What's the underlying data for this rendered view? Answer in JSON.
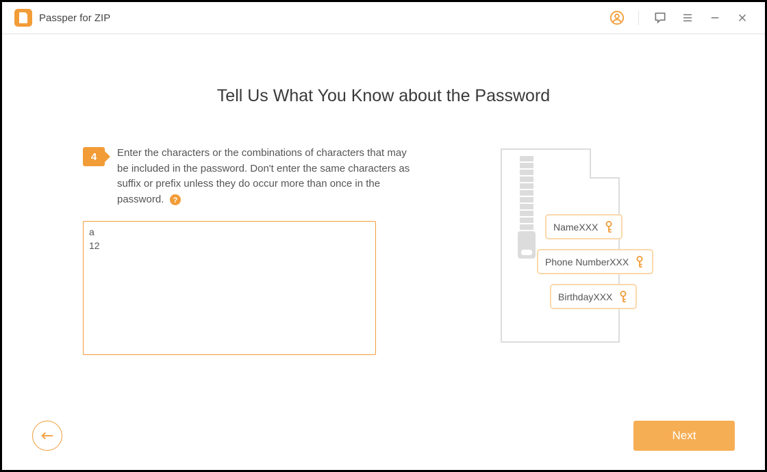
{
  "app": {
    "title": "Passper for ZIP"
  },
  "heading": "Tell Us What You Know about the Password",
  "step": {
    "number": "4",
    "description": "Enter the characters or the combinations of characters that may be included in the password. Don't enter the same characters as suffix or prefix unless they do occur more than once in the password.",
    "input_value": "a\n12"
  },
  "illustration": {
    "tags": [
      "NameXXX",
      "Phone NumberXXX",
      "BirthdayXXX"
    ]
  },
  "footer": {
    "next": "Next"
  }
}
